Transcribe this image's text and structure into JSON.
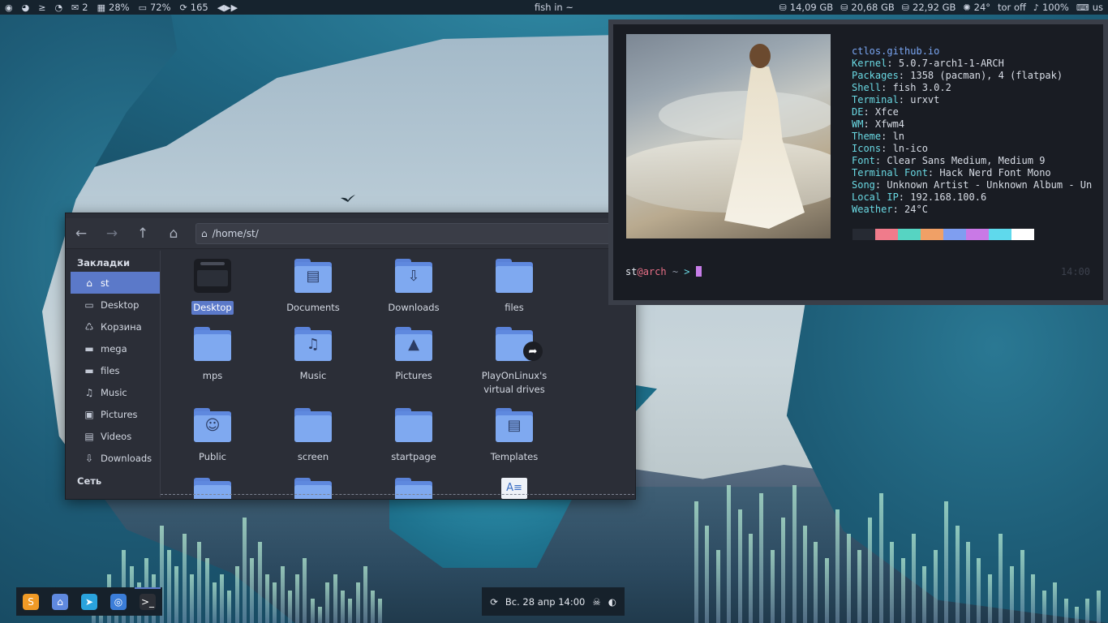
{
  "top_panel": {
    "left": [
      {
        "icon": "debian-icon",
        "glyph": "◉",
        "text": ""
      },
      {
        "icon": "steam-icon",
        "glyph": "◕",
        "text": ""
      },
      {
        "icon": "terminal-icon",
        "glyph": "≥",
        "text": ""
      },
      {
        "icon": "rss-icon",
        "glyph": "◔",
        "text": ""
      },
      {
        "icon": "mail-icon",
        "glyph": "✉",
        "text": "2"
      },
      {
        "icon": "cpu-icon",
        "glyph": "▦",
        "text": "28%"
      },
      {
        "icon": "memory-icon",
        "glyph": "▭",
        "text": "72%"
      },
      {
        "icon": "updates-icon",
        "glyph": "⟳",
        "text": "165"
      },
      {
        "icon": "media-controls-icon",
        "glyph": "◀▶▶",
        "text": ""
      }
    ],
    "title": "fish in ~",
    "right": [
      {
        "icon": "disk-icon",
        "glyph": "⛁",
        "text": "14,09 GB"
      },
      {
        "icon": "disk-icon",
        "glyph": "⛁",
        "text": "20,68 GB"
      },
      {
        "icon": "disk-icon",
        "glyph": "⛁",
        "text": "22,92 GB"
      },
      {
        "icon": "weather-sun-icon",
        "glyph": "✺",
        "text": "24°"
      },
      {
        "icon": "tor-icon",
        "glyph": "",
        "text": "tor off"
      },
      {
        "icon": "volume-icon",
        "glyph": "♪",
        "text": "100%"
      },
      {
        "icon": "keyboard-icon",
        "glyph": "⌨",
        "text": "us"
      }
    ]
  },
  "file_manager": {
    "path": "/home/st/",
    "bookmarks_header": "Закладки",
    "network_header": "Сеть",
    "sidebar": [
      {
        "icon": "home-icon",
        "glyph": "⌂",
        "label": "st",
        "active": true
      },
      {
        "icon": "desktop-icon",
        "glyph": "▭",
        "label": "Desktop"
      },
      {
        "icon": "trash-icon",
        "glyph": "♺",
        "label": "Корзина"
      },
      {
        "icon": "folder-icon",
        "glyph": "▬",
        "label": "mega"
      },
      {
        "icon": "folder-icon",
        "glyph": "▬",
        "label": "files"
      },
      {
        "icon": "music-icon",
        "glyph": "♫",
        "label": "Music"
      },
      {
        "icon": "pictures-icon",
        "glyph": "▣",
        "label": "Pictures"
      },
      {
        "icon": "videos-icon",
        "glyph": "▤",
        "label": "Videos"
      },
      {
        "icon": "downloads-icon",
        "glyph": "⇩",
        "label": "Downloads"
      }
    ],
    "items": [
      {
        "label": "Desktop",
        "kind": "desktop",
        "selected": true
      },
      {
        "label": "Documents",
        "kind": "folder",
        "glyph": "▤"
      },
      {
        "label": "Downloads",
        "kind": "folder",
        "glyph": "⇩"
      },
      {
        "label": "files",
        "kind": "folder",
        "glyph": ""
      },
      {
        "label": "mps",
        "kind": "folder",
        "glyph": ""
      },
      {
        "label": "Music",
        "kind": "folder",
        "glyph": "♫"
      },
      {
        "label": "Pictures",
        "kind": "folder",
        "glyph": "▲"
      },
      {
        "label": "PlayOnLinux's virtual drives",
        "kind": "folder-link",
        "glyph": ""
      },
      {
        "label": "Public",
        "kind": "folder",
        "glyph": "☺"
      },
      {
        "label": "screen",
        "kind": "folder",
        "glyph": ""
      },
      {
        "label": "startpage",
        "kind": "folder",
        "glyph": ""
      },
      {
        "label": "Templates",
        "kind": "folder",
        "glyph": "▤"
      }
    ]
  },
  "terminal": {
    "host_url": "ctlos.github.io",
    "info": [
      {
        "k": "Kernel",
        "v": "5.0.7-arch1-1-ARCH"
      },
      {
        "k": "Packages",
        "v": "1358 (pacman), 4 (flatpak)"
      },
      {
        "k": "Shell",
        "v": "fish 3.0.2"
      },
      {
        "k": "Terminal",
        "v": "urxvt"
      },
      {
        "k": "DE",
        "v": "Xfce"
      },
      {
        "k": "WM",
        "v": "Xfwm4"
      },
      {
        "k": "Theme",
        "v": "ln"
      },
      {
        "k": "Icons",
        "v": "ln-ico"
      },
      {
        "k": "Font",
        "v": "Clear Sans Medium, Medium 9"
      },
      {
        "k": "Terminal Font",
        "v": "Hack Nerd Font Mono"
      },
      {
        "k": "Song",
        "v": "Unknown Artist - Unknown Album - Un"
      },
      {
        "k": "Local IP",
        "v": "192.168.100.6"
      },
      {
        "k": "Weather",
        "v": "24°C"
      }
    ],
    "palette": [
      "#262a33",
      "#f07b8b",
      "#56d4c2",
      "#f0a066",
      "#7f9ef0",
      "#c979e6",
      "#5fd9ec",
      "#ffffff"
    ],
    "prompt_user": "st",
    "prompt_at": "@",
    "prompt_host": "arch",
    "prompt_path": "~",
    "prompt_arrow": ">",
    "right_time": "14:00"
  },
  "dock": [
    {
      "name": "sublime-text-icon",
      "glyph": "S",
      "bg": "#f09a26"
    },
    {
      "name": "file-manager-icon",
      "glyph": "⌂",
      "bg": "#5f89df"
    },
    {
      "name": "telegram-icon",
      "glyph": "➤",
      "bg": "#2aa3dd"
    },
    {
      "name": "chromium-icon",
      "glyph": "◎",
      "bg": "#3b7dd8"
    },
    {
      "name": "terminal-app-icon",
      "glyph": ">_",
      "bg": "#2c2f36"
    }
  ],
  "clock": {
    "refresh_icon": "⟳",
    "text": "Вс. 28 апр 14:00",
    "skull_icon": "☠",
    "theme_icon": "◐"
  },
  "colors": {
    "accent": "#5b79c9",
    "panel": "#16232e",
    "terminal_key": "#6ad9e3"
  }
}
